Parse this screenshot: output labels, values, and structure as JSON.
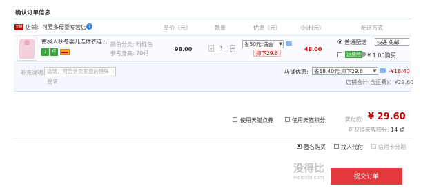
{
  "section_title": "确认订单信息",
  "columns": {
    "unit_price": "单价（元）",
    "quantity": "数量",
    "discount": "优惠（元）",
    "subtotal": "小计(元)",
    "shipping": "配送方式"
  },
  "store": {
    "tag": "天猫",
    "label": "店铺:",
    "name": "可爱多母婴专营店",
    "badge_icon": "chat-icon"
  },
  "item": {
    "title": "南极人秋冬婴儿连体衣连...",
    "service_icons": [
      "seven-day-return-icon",
      "guarantee-icon",
      "credit-card-icon"
    ],
    "service_7": "7",
    "service_bao": "保",
    "spec_color_label": "颜色分类:",
    "spec_color_value": "粉红色",
    "spec_size_label": "参考身高:",
    "spec_size_value": "70码",
    "price": "98.00",
    "qty_minus": "-",
    "qty": "1",
    "qty_plus": "+",
    "promo_select": "省50元:满会",
    "discount_tag": "抑下29.6",
    "subtotal": "48.00"
  },
  "shipping": {
    "method_label": "普通配送",
    "method_value": "快递 免邮",
    "green_tag": "运费险",
    "green_text": "¥ 1.00购买"
  },
  "note": {
    "label": "补充说明:",
    "placeholder": "选填，可告诉卖家您的特殊",
    "wrap": "要求"
  },
  "store_discount": {
    "label": "店铺优惠:",
    "select": "省18.40元:抑下29.6",
    "amount": "-¥18.40",
    "total": "店铺合计(含运费)：¥29.60"
  },
  "options": {
    "tmall_coupon": "使用天猫点券",
    "tmall_points": "使用天猫积分"
  },
  "summary": {
    "paid_label": "实付款:",
    "paid_amount": "¥ 29.60",
    "points_label": "可获得天猫积分:",
    "points_value": "14 点"
  },
  "bottom_options": {
    "anonymous": "匿名购买",
    "proxy": "找人代付",
    "credit_card": "信用卡分期"
  },
  "watermark": "没得比",
  "watermark_sub": "Meidebi.com",
  "submit_label": "提交订单"
}
